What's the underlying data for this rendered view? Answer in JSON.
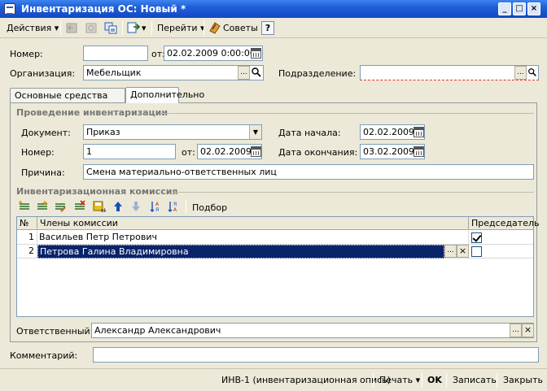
{
  "window": {
    "title": "Инвентаризация ОС: Новый *"
  },
  "toolbar": {
    "actions_label": "Действия",
    "goto_label": "Перейти",
    "tips_label": "Советы",
    "help_label": "?"
  },
  "header": {
    "number_label": "Номер:",
    "number_value": "",
    "from_label": "от:",
    "date_value": "02.02.2009  0:00:00",
    "org_label": "Организация:",
    "org_value": "Мебельщик",
    "dept_label": "Подразделение:",
    "dept_value": ""
  },
  "tabs": [
    {
      "label": "Основные средства",
      "active": false
    },
    {
      "label": "Дополнительно",
      "active": true
    }
  ],
  "conduct": {
    "section_title": "Проведение инвентаризации",
    "doc_label": "Документ:",
    "doc_value": "Приказ",
    "start_label": "Дата начала:",
    "start_value": "02.02.2009",
    "number_label": "Номер:",
    "number_value": "1",
    "from_label": "от:",
    "from_value": "02.02.2009",
    "end_label": "Дата окончания:",
    "end_value": "03.02.2009",
    "reason_label": "Причина:",
    "reason_value": "Смена материально-ответственных лиц"
  },
  "commission": {
    "section_title": "Инвентаризационная комиссия",
    "pick_label": "Подбор",
    "columns": [
      "№",
      "Члены комиссии",
      "Председатель"
    ],
    "rows": [
      {
        "n": "1",
        "name": "Васильев Петр Петрович",
        "chair": true
      },
      {
        "n": "2",
        "name": "Петрова Галина Владимировна",
        "chair": false
      }
    ]
  },
  "responsible": {
    "label": "Ответственный:",
    "value": "Александр Александрович"
  },
  "comment": {
    "label": "Комментарий:",
    "value": ""
  },
  "footer": {
    "print_form": "ИНВ-1 (инвентаризационная опись)",
    "print_label": "Печать",
    "ok_label": "OK",
    "save_label": "Записать",
    "close_label": "Закрыть"
  },
  "colors": {
    "titlebar": "#1f5fd6",
    "selection": "#0a246a",
    "window_bg": "#ece9d8"
  }
}
